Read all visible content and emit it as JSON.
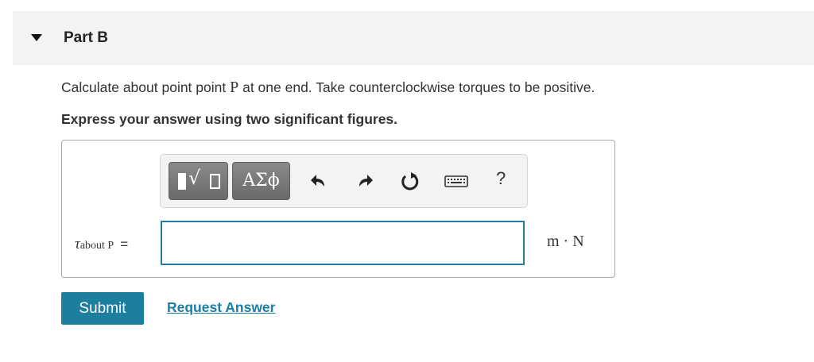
{
  "part": {
    "title": "Part B"
  },
  "question": {
    "prompt_before": "Calculate about point point ",
    "prompt_var": "P",
    "prompt_after": " at one end. Take counterclockwise torques to be positive.",
    "instruction": "Express your answer using two significant figures."
  },
  "toolbar": {
    "symbols_label": "ΑΣϕ",
    "help_label": "?",
    "icons": [
      "templates-icon",
      "undo-icon",
      "redo-icon",
      "reset-icon",
      "keyboard-icon"
    ]
  },
  "answer": {
    "variable": "τ",
    "subscript": "about P",
    "equals": "=",
    "value": "",
    "units": "m · N"
  },
  "actions": {
    "submit_label": "Submit",
    "request_label": "Request Answer"
  },
  "colors": {
    "accent": "#1d7f9e",
    "link": "#1a7fa3",
    "header_bg": "#f3f3f3"
  }
}
